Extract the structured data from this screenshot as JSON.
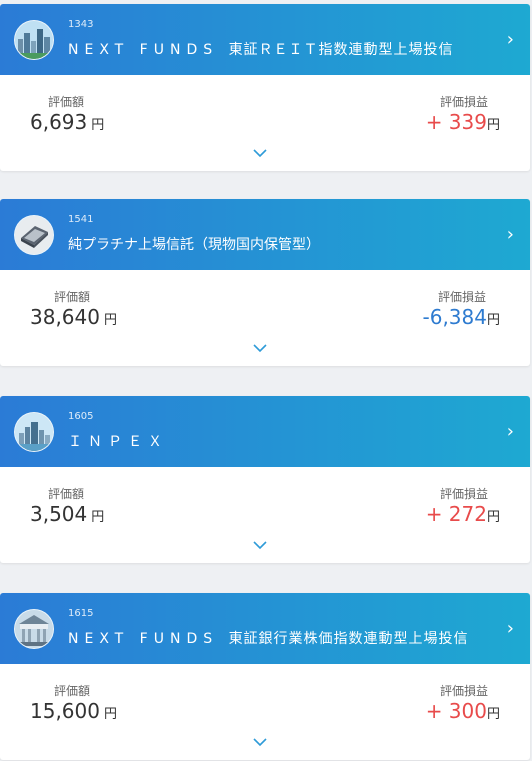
{
  "cards": [
    {
      "code": "1343",
      "name_prefix": "NEXT FUNDS",
      "name_rest": "東証ＲＥＩＴ指数連動型上場投信",
      "valuation_label": "評価額",
      "valuation": "6,693",
      "pl_label": "評価損益",
      "pl": "+ 339",
      "pl_sign": "positive",
      "unit": "円",
      "avatar_icon": "city-skyline-icon"
    },
    {
      "code": "1541",
      "name_prefix": "",
      "name_rest": "純プラチナ上場信託（現物国内保管型）",
      "valuation_label": "評価額",
      "valuation": "38,640",
      "pl_label": "評価損益",
      "pl": "-6,384",
      "pl_sign": "negative",
      "unit": "円",
      "avatar_icon": "platinum-bar-icon"
    },
    {
      "code": "1605",
      "name_prefix": "ＩＮＰＥＸ",
      "name_rest": "",
      "valuation_label": "評価額",
      "valuation": "3,504",
      "pl_label": "評価損益",
      "pl": "+ 272",
      "pl_sign": "positive",
      "unit": "円",
      "avatar_icon": "city-skyline-icon"
    },
    {
      "code": "1615",
      "name_prefix": "NEXT FUNDS",
      "name_rest": "東証銀行業株価指数連動型上場投信",
      "valuation_label": "評価額",
      "valuation": "15,600",
      "pl_label": "評価損益",
      "pl": "+ 300",
      "pl_sign": "positive",
      "unit": "円",
      "avatar_icon": "bank-building-icon"
    }
  ],
  "colors": {
    "header_start": "#2b7bd6",
    "header_end": "#1ea9d2",
    "positive": "#e84b4b",
    "negative": "#2e7bd0"
  }
}
